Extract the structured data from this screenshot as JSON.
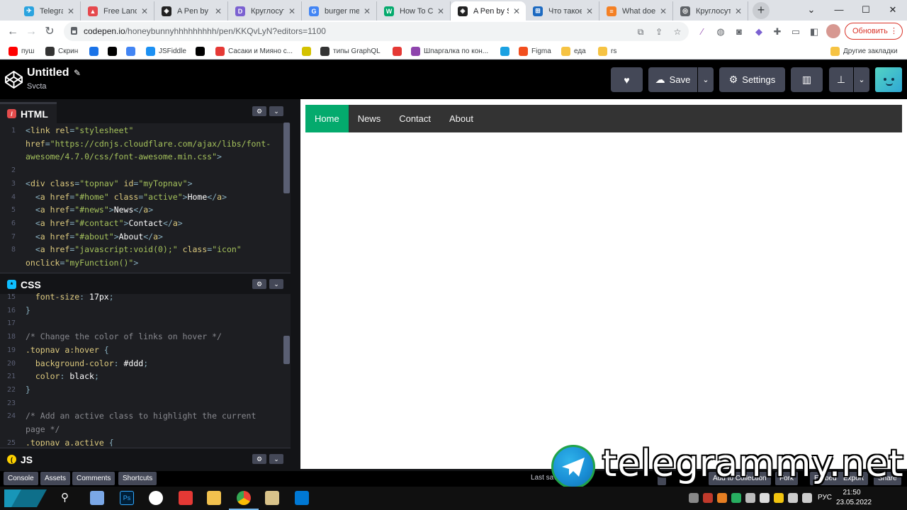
{
  "browser": {
    "tabs": [
      {
        "title": "Telegram",
        "color": "#2aa3df",
        "glyph": "✈"
      },
      {
        "title": "Free Landing",
        "color": "#e5484d",
        "glyph": "▲"
      },
      {
        "title": "A Pen by Sv",
        "color": "#222222",
        "glyph": "◈"
      },
      {
        "title": "Круглосуто",
        "color": "#7b61d1",
        "glyph": "D"
      },
      {
        "title": "burger men",
        "color": "#4285f4",
        "glyph": "G"
      },
      {
        "title": "How To Cre",
        "color": "#04aa6d",
        "glyph": "W"
      },
      {
        "title": "A Pen by Sv",
        "color": "#222222",
        "glyph": "◈",
        "active": true
      },
      {
        "title": "Что такое",
        "color": "#1d6ac1",
        "glyph": "⊞"
      },
      {
        "title": "What does",
        "color": "#f48024",
        "glyph": "≡"
      },
      {
        "title": "Круглосуто",
        "color": "#5f6368",
        "glyph": "◎"
      }
    ],
    "new_tab_glyph": "+",
    "window_controls": {
      "menu": "⌄",
      "minimize": "—",
      "maximize": "☐",
      "close": "✕"
    },
    "url_host": "codepen.io",
    "url_path": "/honeybunnyhhhhhhhhh/pen/KKQvLyN?editors=1100",
    "update_button": "Обновить",
    "bookmarks": [
      {
        "label": "пуш",
        "color": "#ff0000"
      },
      {
        "label": "Скрин",
        "color": "#333333"
      },
      {
        "label": "",
        "color": "#1a73e8"
      },
      {
        "label": "",
        "color": "#000000"
      },
      {
        "label": "",
        "color": "#4285f4"
      },
      {
        "label": "JSFiddle",
        "color": "#1c90f3"
      },
      {
        "label": "",
        "color": "#000000"
      },
      {
        "label": "Сасаки и Мияно с...",
        "color": "#e53935"
      },
      {
        "label": "",
        "color": "#d4c200"
      },
      {
        "label": "типы GraphQL",
        "color": "#333333"
      },
      {
        "label": "",
        "color": "#e53935"
      },
      {
        "label": "Шпаргалка по кон...",
        "color": "#8e44ad"
      },
      {
        "label": "",
        "color": "#1ba1e2"
      },
      {
        "label": "Figma",
        "color": "#f24e1e"
      },
      {
        "label": "еда",
        "color": "#f6c343"
      },
      {
        "label": "rs",
        "color": "#f6c343"
      }
    ],
    "other_bookmarks": "Другие закладки"
  },
  "header": {
    "title": "Untitled",
    "author": "Svcta",
    "save_label": "Save",
    "settings_label": "Settings"
  },
  "editors": {
    "html": {
      "label": "HTML",
      "lines": [
        {
          "n": "1",
          "parts": [
            [
              "t-punc",
              "<"
            ],
            [
              "t-tag",
              "link "
            ],
            [
              "t-attr",
              "rel"
            ],
            [
              "t-punc",
              "="
            ],
            [
              "t-str",
              "\"stylesheet\""
            ]
          ]
        },
        {
          "n": "",
          "parts": [
            [
              "t-attr",
              "href"
            ],
            [
              "t-punc",
              "="
            ],
            [
              "t-str",
              "\"https://cdnjs.cloudflare.com/ajax/libs/font-"
            ]
          ]
        },
        {
          "n": "",
          "parts": [
            [
              "t-str",
              "awesome/4.7.0/css/font-awesome.min.css\""
            ],
            [
              "t-punc",
              ">"
            ]
          ]
        },
        {
          "n": "2",
          "parts": []
        },
        {
          "n": "3",
          "parts": [
            [
              "t-punc",
              "<"
            ],
            [
              "t-tag",
              "div "
            ],
            [
              "t-attr",
              "class"
            ],
            [
              "t-punc",
              "="
            ],
            [
              "t-str",
              "\"topnav\" "
            ],
            [
              "t-attr",
              "id"
            ],
            [
              "t-punc",
              "="
            ],
            [
              "t-str",
              "\"myTopnav\""
            ],
            [
              "t-punc",
              ">"
            ]
          ]
        },
        {
          "n": "4",
          "parts": [
            [
              "t-txt",
              "  "
            ],
            [
              "t-punc",
              "<"
            ],
            [
              "t-tag",
              "a "
            ],
            [
              "t-attr",
              "href"
            ],
            [
              "t-punc",
              "="
            ],
            [
              "t-str",
              "\"#home\" "
            ],
            [
              "t-attr",
              "class"
            ],
            [
              "t-punc",
              "="
            ],
            [
              "t-str",
              "\"active\""
            ],
            [
              "t-punc",
              ">"
            ],
            [
              "t-txt",
              "Home"
            ],
            [
              "t-punc",
              "</"
            ],
            [
              "t-tag",
              "a"
            ],
            [
              "t-punc",
              ">"
            ]
          ]
        },
        {
          "n": "5",
          "parts": [
            [
              "t-txt",
              "  "
            ],
            [
              "t-punc",
              "<"
            ],
            [
              "t-tag",
              "a "
            ],
            [
              "t-attr",
              "href"
            ],
            [
              "t-punc",
              "="
            ],
            [
              "t-str",
              "\"#news\""
            ],
            [
              "t-punc",
              ">"
            ],
            [
              "t-txt",
              "News"
            ],
            [
              "t-punc",
              "</"
            ],
            [
              "t-tag",
              "a"
            ],
            [
              "t-punc",
              ">"
            ]
          ]
        },
        {
          "n": "6",
          "parts": [
            [
              "t-txt",
              "  "
            ],
            [
              "t-punc",
              "<"
            ],
            [
              "t-tag",
              "a "
            ],
            [
              "t-attr",
              "href"
            ],
            [
              "t-punc",
              "="
            ],
            [
              "t-str",
              "\"#contact\""
            ],
            [
              "t-punc",
              ">"
            ],
            [
              "t-txt",
              "Contact"
            ],
            [
              "t-punc",
              "</"
            ],
            [
              "t-tag",
              "a"
            ],
            [
              "t-punc",
              ">"
            ]
          ]
        },
        {
          "n": "7",
          "parts": [
            [
              "t-txt",
              "  "
            ],
            [
              "t-punc",
              "<"
            ],
            [
              "t-tag",
              "a "
            ],
            [
              "t-attr",
              "href"
            ],
            [
              "t-punc",
              "="
            ],
            [
              "t-str",
              "\"#about\""
            ],
            [
              "t-punc",
              ">"
            ],
            [
              "t-txt",
              "About"
            ],
            [
              "t-punc",
              "</"
            ],
            [
              "t-tag",
              "a"
            ],
            [
              "t-punc",
              ">"
            ]
          ]
        },
        {
          "n": "8",
          "parts": [
            [
              "t-txt",
              "  "
            ],
            [
              "t-punc",
              "<"
            ],
            [
              "t-tag",
              "a "
            ],
            [
              "t-attr",
              "href"
            ],
            [
              "t-punc",
              "="
            ],
            [
              "t-str",
              "\"javascript:void(0);\" "
            ],
            [
              "t-attr",
              "class"
            ],
            [
              "t-punc",
              "="
            ],
            [
              "t-str",
              "\"icon\""
            ]
          ]
        },
        {
          "n": "",
          "parts": [
            [
              "t-attr",
              "onclick"
            ],
            [
              "t-punc",
              "="
            ],
            [
              "t-str",
              "\"myFunction()\""
            ],
            [
              "t-punc",
              ">"
            ]
          ]
        }
      ]
    },
    "css": {
      "label": "CSS",
      "lines": [
        {
          "n": "15",
          "parts": [
            [
              "t-prop",
              "  font-size"
            ],
            [
              "t-punc",
              ": "
            ],
            [
              "t-val",
              "17px"
            ],
            [
              "t-punc",
              ";"
            ]
          ]
        },
        {
          "n": "16",
          "parts": [
            [
              "t-punc",
              "}"
            ]
          ]
        },
        {
          "n": "17",
          "parts": []
        },
        {
          "n": "18",
          "parts": [
            [
              "t-com",
              "/* Change the color of links on hover */"
            ]
          ]
        },
        {
          "n": "19",
          "parts": [
            [
              "t-sel",
              ".topnav a:hover "
            ],
            [
              "t-punc",
              "{"
            ]
          ]
        },
        {
          "n": "20",
          "parts": [
            [
              "t-prop",
              "  background-color"
            ],
            [
              "t-punc",
              ": "
            ],
            [
              "t-val",
              "#ddd"
            ],
            [
              "t-punc",
              ";"
            ]
          ]
        },
        {
          "n": "21",
          "parts": [
            [
              "t-prop",
              "  color"
            ],
            [
              "t-punc",
              ": "
            ],
            [
              "t-val",
              "black"
            ],
            [
              "t-punc",
              ";"
            ]
          ]
        },
        {
          "n": "22",
          "parts": [
            [
              "t-punc",
              "}"
            ]
          ]
        },
        {
          "n": "23",
          "parts": []
        },
        {
          "n": "24",
          "parts": [
            [
              "t-com",
              "/* Add an active class to highlight the current"
            ]
          ]
        },
        {
          "n": "",
          "parts": [
            [
              "t-com",
              "page */"
            ]
          ]
        },
        {
          "n": "25",
          "parts": [
            [
              "t-sel",
              ".topnav a.active "
            ],
            [
              "t-punc",
              "{"
            ]
          ]
        }
      ]
    },
    "js": {
      "label": "JS"
    }
  },
  "footer": {
    "buttons": [
      "Console",
      "Assets",
      "Comments",
      "Shortcuts"
    ],
    "status": "Last sav",
    "right_buttons": [
      "",
      "Add to Collection",
      "Fork",
      "Embed",
      "Export",
      "Share"
    ]
  },
  "preview": {
    "nav": [
      {
        "label": "Home",
        "active": true
      },
      {
        "label": "News"
      },
      {
        "label": "Contact"
      },
      {
        "label": "About"
      }
    ],
    "active_color": "#04aa6d",
    "nav_bg": "#333333"
  },
  "watermark": "telegrammy.net",
  "taskbar": {
    "time": "21:50",
    "date": "23.05.2022",
    "lang": "РУС"
  }
}
